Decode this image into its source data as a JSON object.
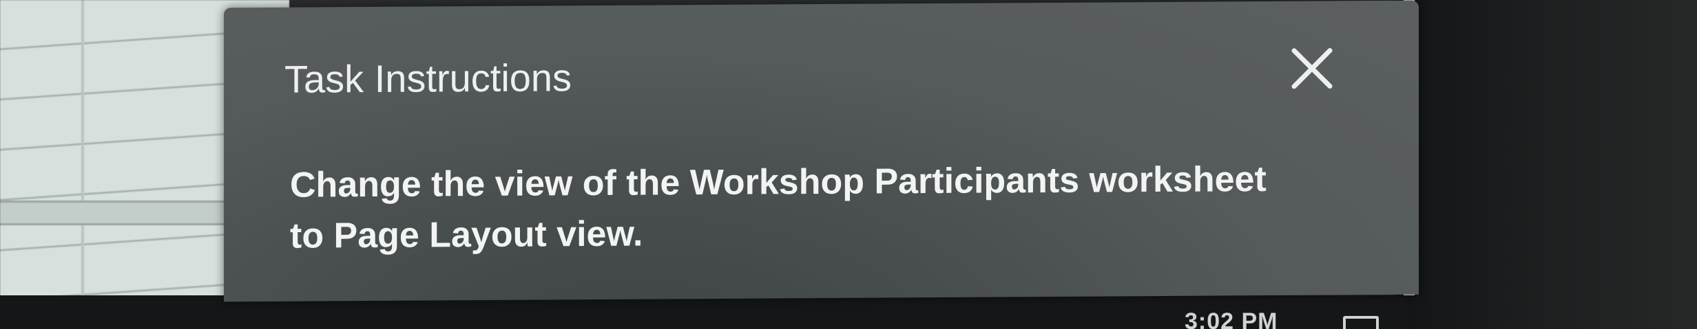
{
  "dialog": {
    "title": "Task Instructions",
    "close_icon": "close-icon",
    "body_line1": "Change the view of the Workshop Participants worksheet",
    "body_line2": "to Page Layout view."
  },
  "taskbar": {
    "clock": "3:02 PM",
    "notification_icon": "notification-icon"
  },
  "colors": {
    "panel_bg": "#555a5b",
    "text": "#f2f4f4",
    "taskbar_bg": "#141617"
  }
}
